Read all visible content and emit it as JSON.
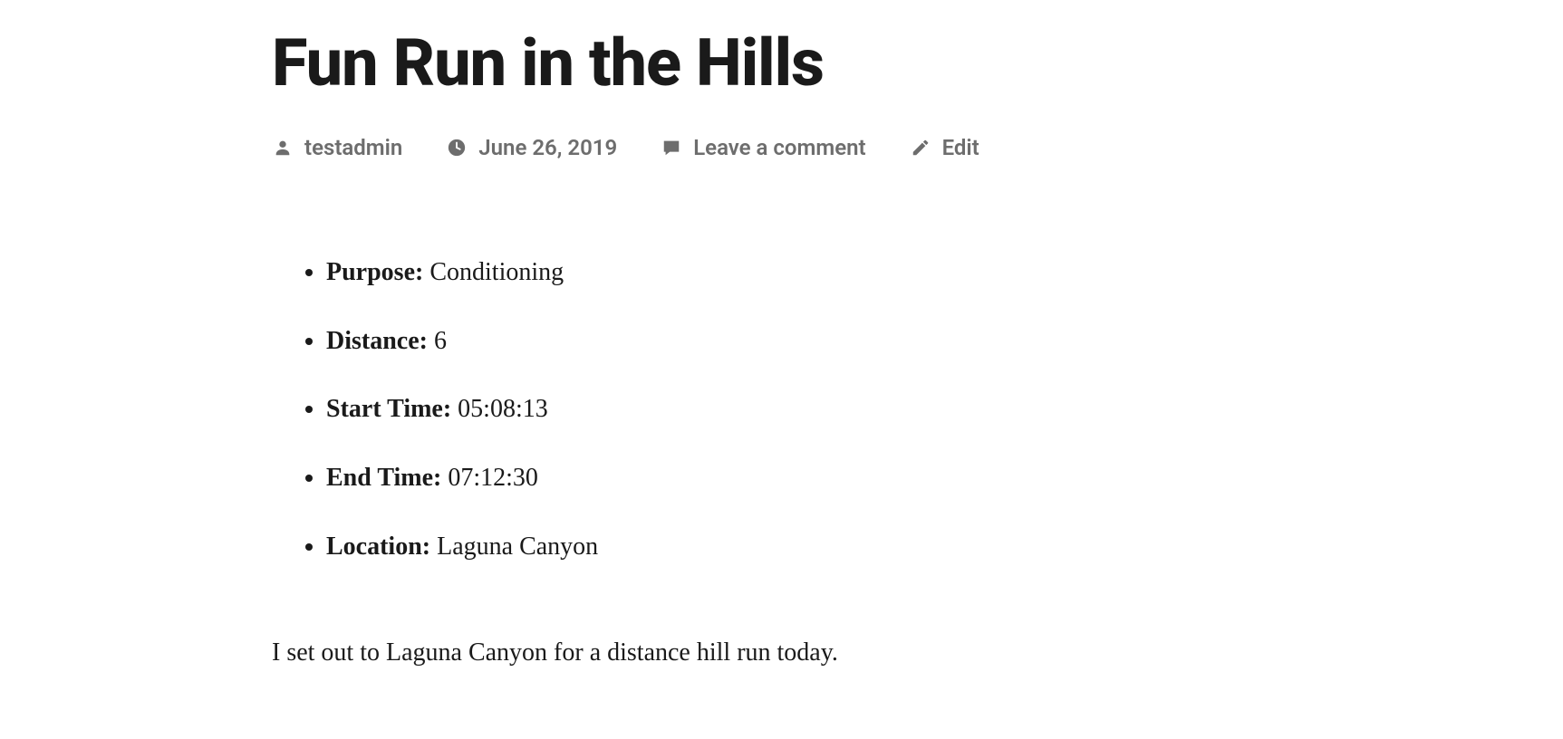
{
  "post": {
    "title": "Fun Run in the Hills",
    "author": "testadmin",
    "date": "June 26, 2019",
    "comment_link": "Leave a comment",
    "edit_link": "Edit"
  },
  "details": {
    "purpose_label": "Purpose:",
    "purpose_value": "Conditioning",
    "distance_label": "Distance:",
    "distance_value": "6",
    "start_time_label": "Start Time:",
    "start_time_value": "05:08:13",
    "end_time_label": "End Time:",
    "end_time_value": "07:12:30",
    "location_label": "Location:",
    "location_value": "Laguna Canyon"
  },
  "body": {
    "paragraph1": "I set out to Laguna Canyon for a distance hill run today."
  }
}
